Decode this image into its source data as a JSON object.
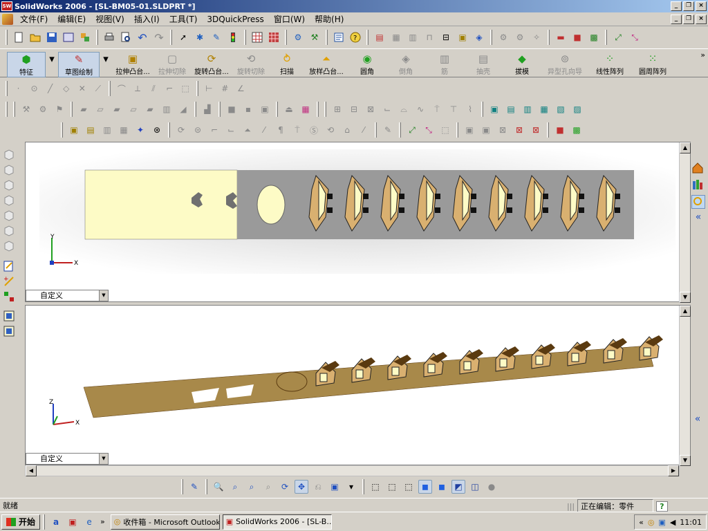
{
  "window": {
    "title": "SolidWorks 2006 - [SL-BM05-01.SLDPRT *]",
    "app_icon_text": "SW"
  },
  "menu": {
    "items": [
      "文件(F)",
      "编辑(E)",
      "视图(V)",
      "插入(I)",
      "工具(T)",
      "3DQuickPress",
      "窗口(W)",
      "帮助(H)"
    ]
  },
  "features": {
    "items": [
      {
        "label": "特征"
      },
      {
        "label": "草图绘制"
      },
      {
        "label": "拉伸凸台..."
      },
      {
        "label": "拉伸切除"
      },
      {
        "label": "旋转凸台..."
      },
      {
        "label": "旋转切除"
      },
      {
        "label": "扫描"
      },
      {
        "label": "放样凸台..."
      },
      {
        "label": "圆角"
      },
      {
        "label": "倒角"
      },
      {
        "label": "筋"
      },
      {
        "label": "抽壳"
      },
      {
        "label": "拔模"
      },
      {
        "label": "异型孔向导"
      },
      {
        "label": "线性阵列"
      },
      {
        "label": "圆周阵列"
      }
    ]
  },
  "viewports": {
    "top_combo": "自定义",
    "bottom_combo": "自定义",
    "top_axis": {
      "y": "Y",
      "x": "X"
    },
    "bottom_axis": {
      "z": "Z",
      "x": "X"
    }
  },
  "status": {
    "left": "就绪",
    "editing": "正在编辑：零件",
    "help": "?"
  },
  "taskbar": {
    "start": "开始",
    "outlook": "收件箱 - Microsoft Outlook",
    "solidworks": "SolidWorks 2006 - [SL-B...",
    "more": "»",
    "tray_more": "«",
    "clock": "11:01"
  },
  "colors": {
    "part_face": "#fdfbc6",
    "part_side": "#a8894a",
    "part_dark": "#7a5a20"
  }
}
